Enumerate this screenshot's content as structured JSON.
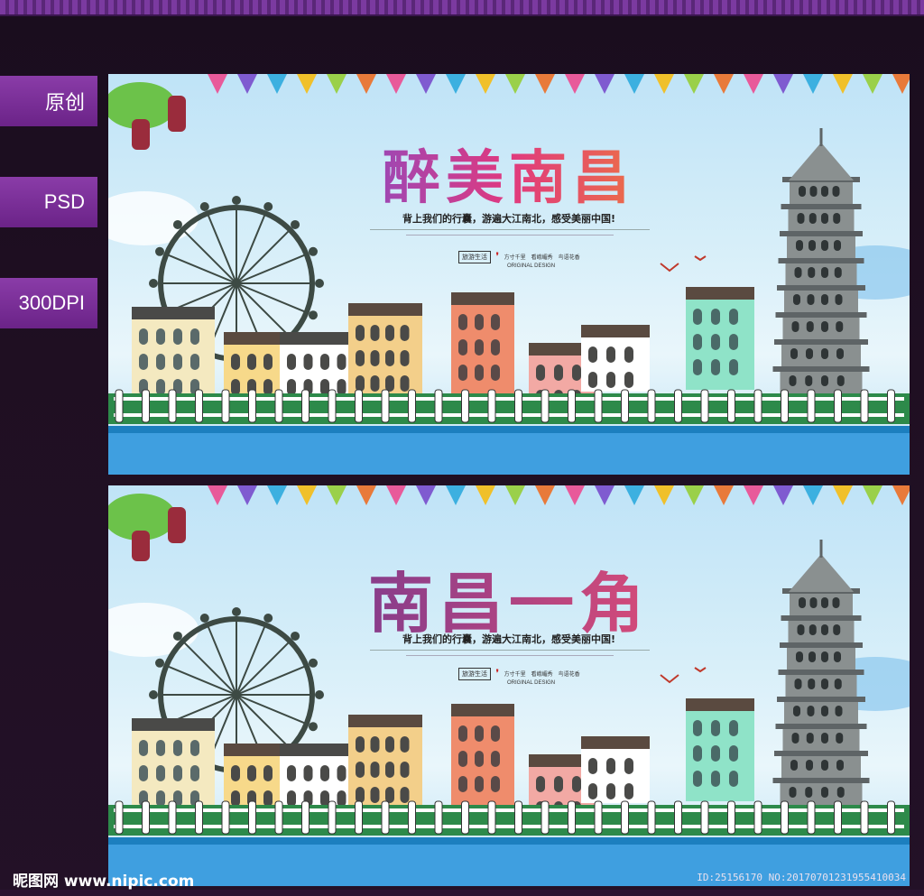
{
  "tags": {
    "original": "原创",
    "format": "PSD",
    "resolution": "300DPI"
  },
  "poster1": {
    "title": "醉美南昌",
    "slogan": "背上我们的行囊，游遍大江南北，感受美丽中国!",
    "seal_text": "旅游生活",
    "design_text": "ORIGINAL DESIGN",
    "motto": "方寸千里　看峨嵋秀　鸟语花香"
  },
  "poster2": {
    "title": "南昌一角",
    "slogan": "背上我们的行囊，游遍大江南北，感受美丽中国!",
    "seal_text": "旅游生活",
    "design_text": "ORIGINAL DESIGN",
    "motto": "方寸千里　看峨嵋秀　鸟语花香"
  },
  "watermark": {
    "site": "昵图网 www.nipic.com",
    "id_text": "ID:25156170 NO:20170701231955410034"
  },
  "colors": {
    "frame_bg": "#1f0f22",
    "tag_purple": "#7b2f9a",
    "sky": "#cfeaf8",
    "water": "#3f9fe0",
    "grass": "#2d8a4a"
  }
}
